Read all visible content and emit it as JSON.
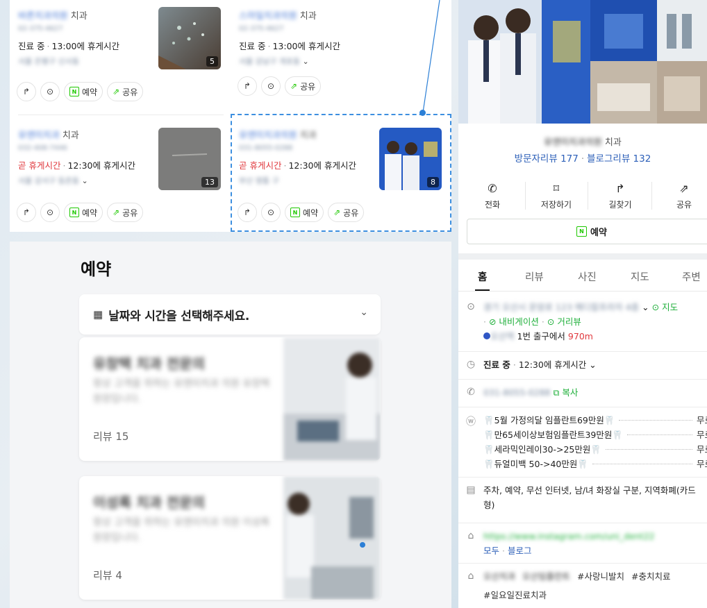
{
  "list": {
    "cards": [
      {
        "name": "바른치과의원",
        "category": "치과",
        "phone": "02-375-4627",
        "status": "진료 중",
        "status_red": false,
        "status_detail": "13:00에 휴게시간",
        "address": "서울 은평구 신사동",
        "photo_count": "5"
      },
      {
        "name": "스마일치과의원",
        "category": "치과",
        "phone": "02-375-4627",
        "status": "진료 중",
        "status_red": false,
        "status_detail": "13:00에 휴게시간",
        "address": "서울 강남구 개포동",
        "photo_count": ""
      },
      {
        "name": "유앤미치과",
        "category": "치과",
        "phone": "032-408-7446",
        "status": "곧 휴게시간",
        "status_red": true,
        "status_detail": "12:30에 휴게시간",
        "address": "서울 강서구 등촌동",
        "photo_count": "13"
      },
      {
        "name": "유앤미치과의원",
        "category": "치과",
        "phone": "031-8055-0288",
        "status": "곧 휴게시간",
        "status_red": true,
        "status_detail": "12:30에 휴게시간",
        "address": "부산 영통 구",
        "photo_count": "8"
      }
    ],
    "reserve_label": "예약",
    "share_label": "공유"
  },
  "reserve": {
    "title": "예약",
    "date_placeholder": "날짜와 시간을 선택해주세요.",
    "services": [
      {
        "title": "유창택 치과 전문의",
        "desc": "항상 고객을 위하는 유앤미치과 의원 유창택 원장입니다.",
        "review": "리뷰 15"
      },
      {
        "title": "이성록 치과 전문의",
        "desc": "항상 고객을 위하는 유앤미치과 의원 이성록 원장입니다.",
        "review": "리뷰 4"
      }
    ]
  },
  "detail": {
    "name": "유앤미치과의원",
    "category": "치과",
    "visitor_reviews": "방문자리뷰 177",
    "blog_reviews": "블로그리뷰 132",
    "actions": {
      "call": "전화",
      "save": "저장하기",
      "directions": "길찾기",
      "share": "공유"
    },
    "reserve_label": "예약",
    "tabs": [
      "홈",
      "리뷰",
      "사진",
      "지도",
      "주변"
    ],
    "address": "경기 오산시 운암로 123 메디칼프라자 4층",
    "map_link": "지도",
    "navigation": "내비게이션",
    "street_view": "거리뷰",
    "subway_station": "오산역",
    "exit_text": "1번 출구에서",
    "distance": "970m",
    "hours_status": "진료 중",
    "hours_detail": "12:30에 휴게시간",
    "phone": "031-8055-0288",
    "copy_label": "복사",
    "prices": [
      {
        "item": "5월 가정의달 임플란트69만원",
        "price": "무료"
      },
      {
        "item": "만65세이상보험임플란트39만원",
        "price": "무료"
      },
      {
        "item": "세라믹인레이30->25만원",
        "price": "무료"
      },
      {
        "item": "듀얼미백 50->40만원",
        "price": "무료"
      }
    ],
    "amenities": "주차, 예약, 무선 인터넷, 남/녀 화장실 구분, 지역화폐(카드형)",
    "homepage_url": "https://www.instagram.com/uni_dent22",
    "links": [
      "모두",
      "블로그"
    ],
    "keywords_blurred": [
      "오산치과",
      "오산임플란트"
    ],
    "keywords": [
      "#사랑니발치",
      "#충치치료",
      "#일요일진료치과"
    ]
  }
}
